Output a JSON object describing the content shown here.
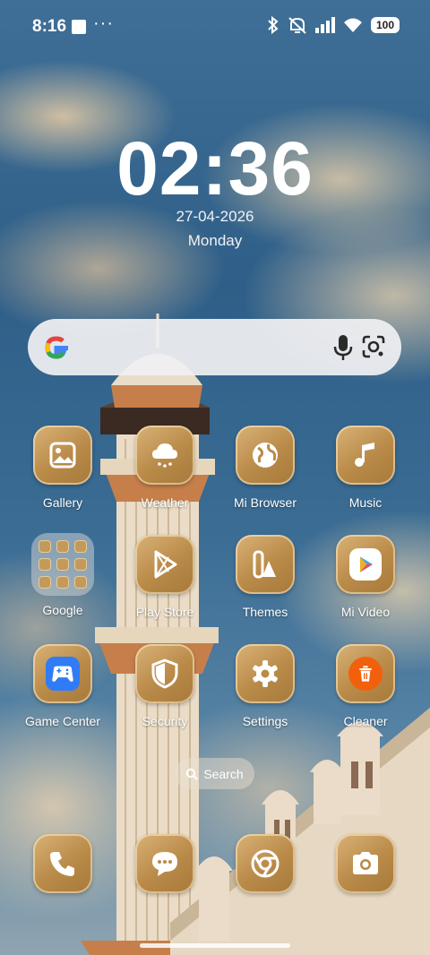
{
  "status_bar": {
    "time": "8:16",
    "dots": "···",
    "battery": "100"
  },
  "clock": {
    "time": "02:36",
    "date": "27-04-2026",
    "weekday": "Monday"
  },
  "search_widget": {
    "icons": [
      "google-logo",
      "mic-icon",
      "google-lens-icon"
    ]
  },
  "apps": {
    "gallery": "Gallery",
    "weather": "Weather",
    "mi_browser": "Mi Browser",
    "music": "Music",
    "google": "Google",
    "play_store": "Play Store",
    "themes": "Themes",
    "mi_video": "Mi Video",
    "game_center": "Game Center",
    "security": "Security",
    "settings": "Settings",
    "cleaner": "Cleaner"
  },
  "drawer_search": {
    "label": "Search"
  },
  "dock": [
    "phone-icon",
    "messages-icon",
    "chrome-icon",
    "camera-icon"
  ],
  "colors": {
    "icon_gold": "#b98a48",
    "search_bar": "#f0f0f2"
  }
}
